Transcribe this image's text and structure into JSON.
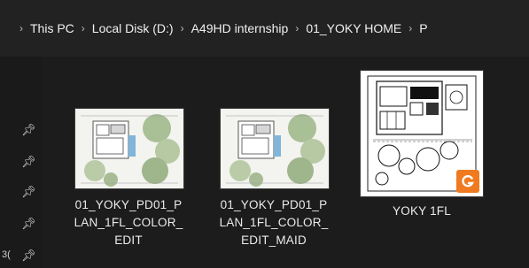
{
  "breadcrumb": {
    "items": [
      "This PC",
      "Local Disk (D:)",
      "A49HD internship",
      "01_YOKY HOME",
      "P"
    ]
  },
  "sidebar": {
    "pin_count": 5,
    "partial_label": "3("
  },
  "files": [
    {
      "name_lines": [
        "01_YOKY_PD01_P",
        "LAN_1FL_COLOR_",
        "EDIT"
      ],
      "thumbnail": "color-site-plan",
      "badge": ""
    },
    {
      "name_lines": [
        "01_YOKY_PD01_P",
        "LAN_1FL_COLOR_",
        "EDIT_MAID"
      ],
      "thumbnail": "color-site-plan",
      "badge": ""
    },
    {
      "name_lines": [
        "YOKY 1FL"
      ],
      "thumbnail": "cad-drawing",
      "badge": "autocad-icon"
    }
  ],
  "colors": {
    "background": "#1c1c1c",
    "address_bar": "#222222",
    "badge_orange": "#f07a1f"
  }
}
